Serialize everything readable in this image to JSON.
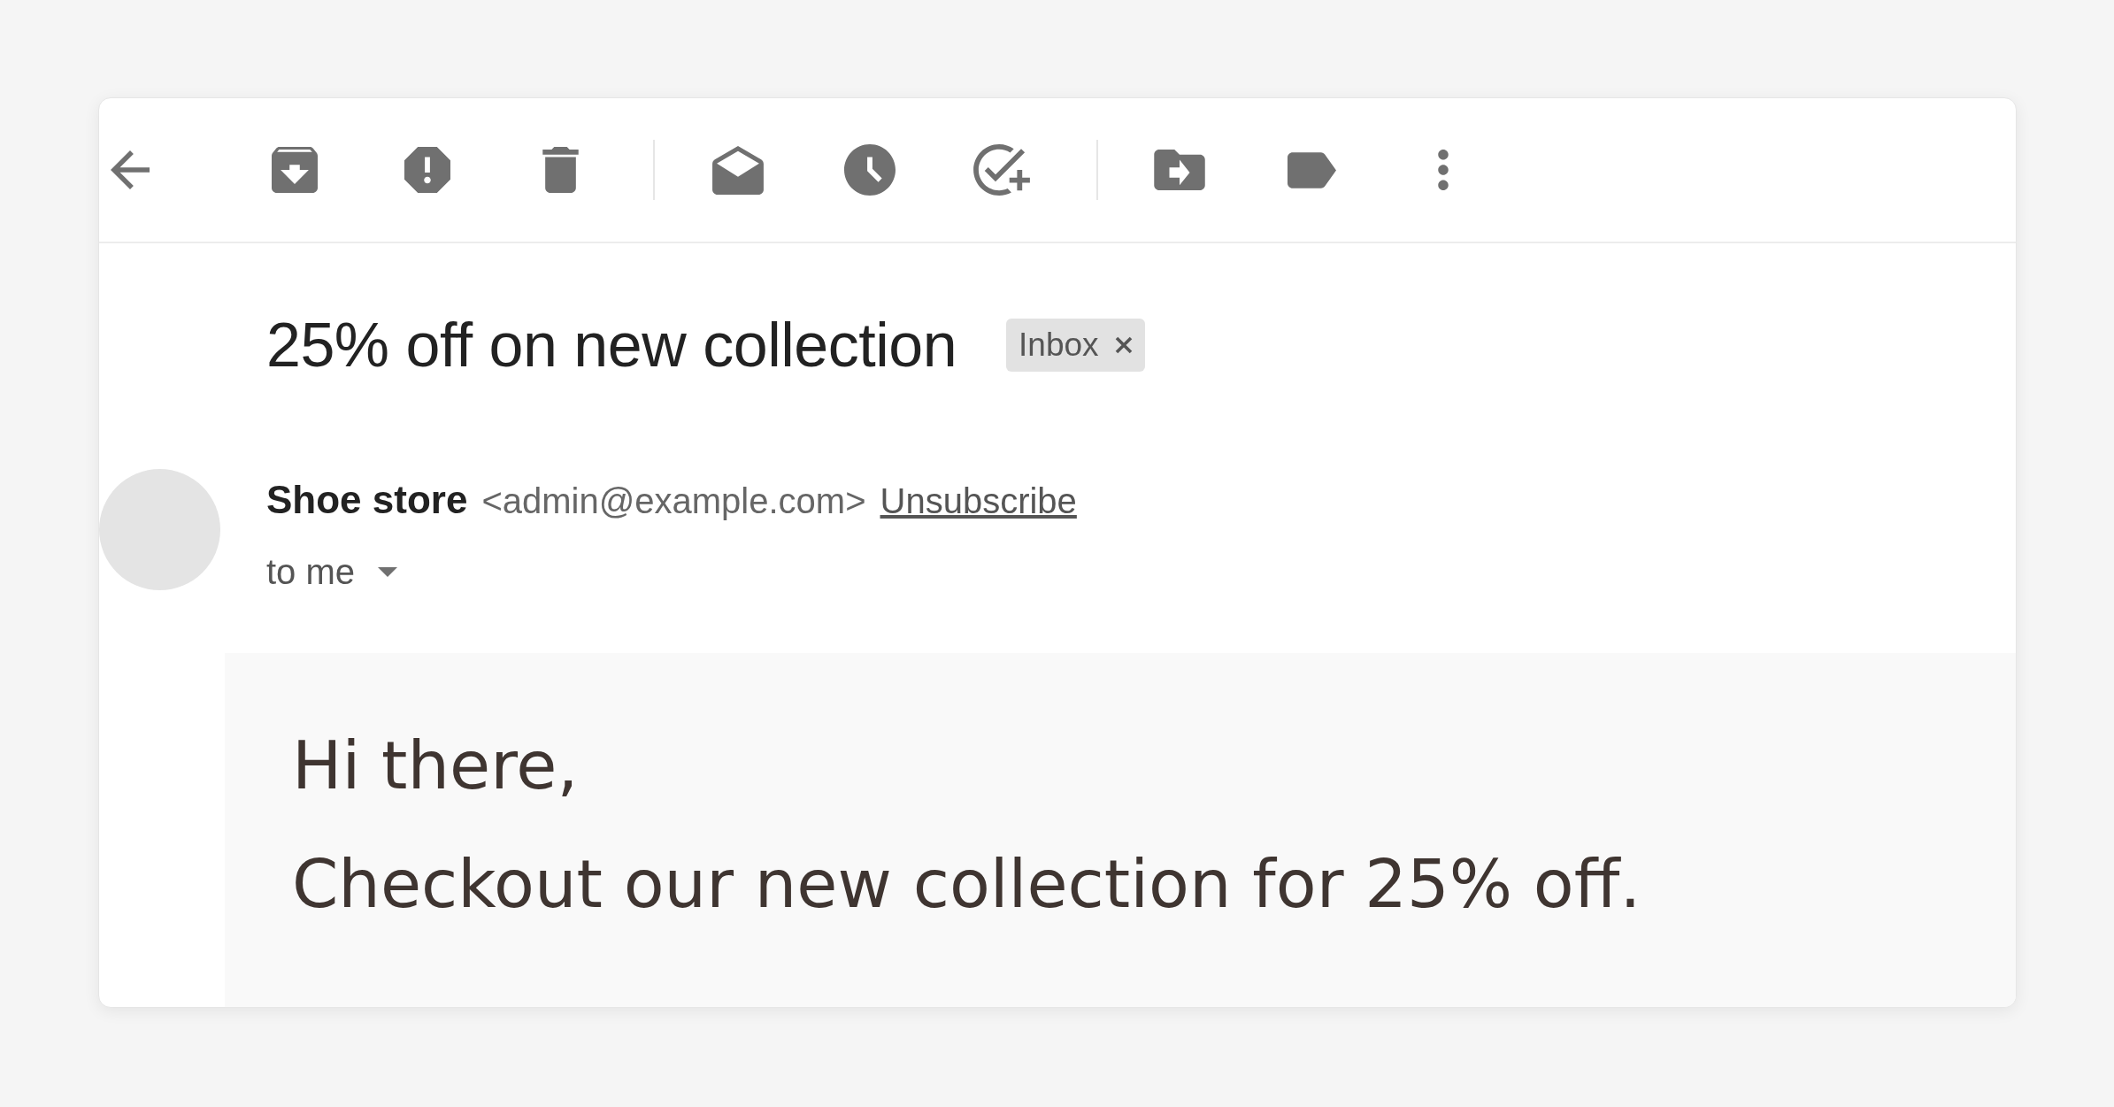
{
  "message": {
    "subject": "25% off on new collection",
    "labels": [
      {
        "text": "Inbox"
      }
    ],
    "sender": {
      "name": "Shoe store",
      "email": "<admin@example.com>",
      "unsubscribe": "Unsubscribe"
    },
    "recipient": "to me",
    "body": [
      "Hi there,",
      "Checkout our new collection for 25% off."
    ]
  }
}
